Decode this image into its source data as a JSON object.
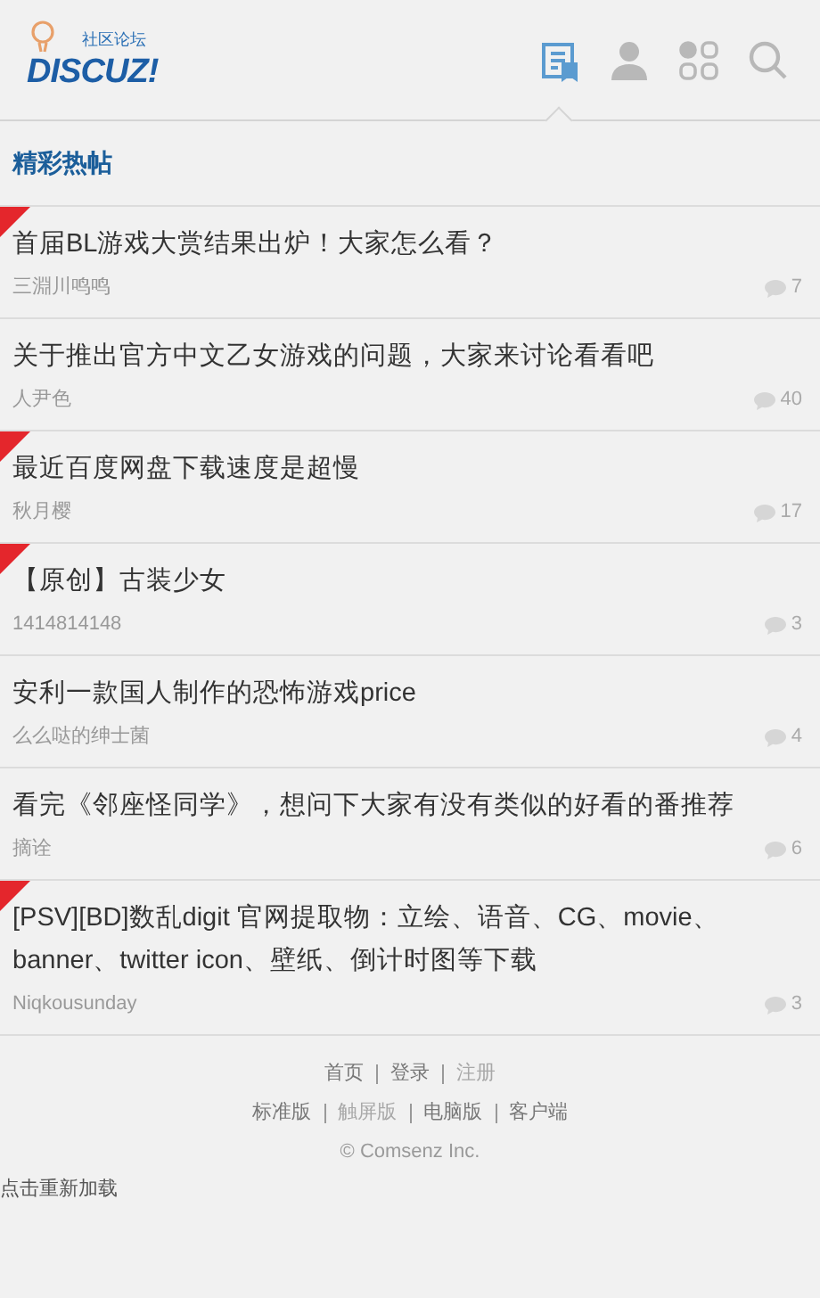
{
  "logo": {
    "tagline": "社区论坛",
    "wordmark": "DISCUZ!"
  },
  "nav_icons": [
    {
      "kind": "posts",
      "selected": true
    },
    {
      "kind": "user",
      "selected": false
    },
    {
      "kind": "apps",
      "selected": false
    },
    {
      "kind": "search",
      "selected": false
    }
  ],
  "section_title": "精彩热帖",
  "threads": [
    {
      "title": "首届BL游戏大赏结果出炉！大家怎么看？",
      "author": "三淵川鸣鸣",
      "replies": "7",
      "flagged": true
    },
    {
      "title": "关于推出官方中文乙女游戏的问题，大家来讨论看看吧",
      "author": "人尹色",
      "replies": "40",
      "flagged": false
    },
    {
      "title": "最近百度网盘下载速度是超慢",
      "author": "秋月樱",
      "replies": "17",
      "flagged": true
    },
    {
      "title": "【原创】古装少女",
      "author": "1414814148",
      "replies": "3",
      "flagged": true
    },
    {
      "title": "安利一款国人制作的恐怖游戏price",
      "author": "么么哒的绅士菌",
      "replies": "4",
      "flagged": false
    },
    {
      "title": "看完《邻座怪同学》，想问下大家有没有类似的好看的番推荐",
      "author": "摘诠",
      "replies": "6",
      "flagged": false
    },
    {
      "title": "[PSV][BD]数乱digit 官网提取物：立绘、语音、CG、movie、banner、twitter icon、壁纸、倒计时图等下载",
      "author": "Niqkousunday",
      "replies": "3",
      "flagged": true
    }
  ],
  "footer_rows": [
    [
      {
        "label": "首页",
        "dimmed": false
      },
      {
        "label": "登录",
        "dimmed": false
      },
      {
        "label": "注册",
        "dimmed": true
      }
    ],
    [
      {
        "label": "标准版",
        "dimmed": false
      },
      {
        "label": "触屏版",
        "dimmed": true
      },
      {
        "label": "电脑版",
        "dimmed": false
      },
      {
        "label": "客户端",
        "dimmed": false
      }
    ]
  ],
  "copyright": "© Comsenz Inc.",
  "reload_hint": "点击重新加载"
}
